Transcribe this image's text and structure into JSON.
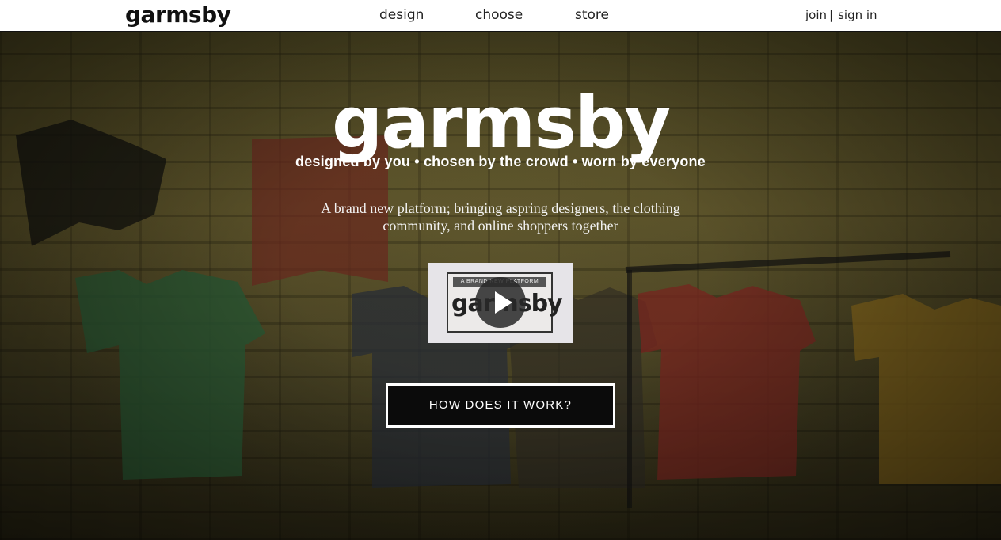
{
  "header": {
    "logo": "garmsby",
    "nav": [
      "design",
      "choose",
      "store"
    ],
    "join": "join",
    "separator": "|",
    "sign_in": "sign in"
  },
  "hero": {
    "brand": "garmsby",
    "tagline": "designed by you • chosen by the crowd • worn by everyone",
    "description": "A brand new platform; bringing aspring designers, the clothing community, and online shoppers together",
    "video": {
      "ribbon": "A BRAND NEW PLATFORM",
      "wordmark": "garmsby",
      "play_icon": "play-icon"
    },
    "cta": "HOW DOES IT WORK?"
  },
  "colors": {
    "header_bg": "#ffffff",
    "hero_text": "#ffffff",
    "cta_bg": "#0b0b0b"
  }
}
